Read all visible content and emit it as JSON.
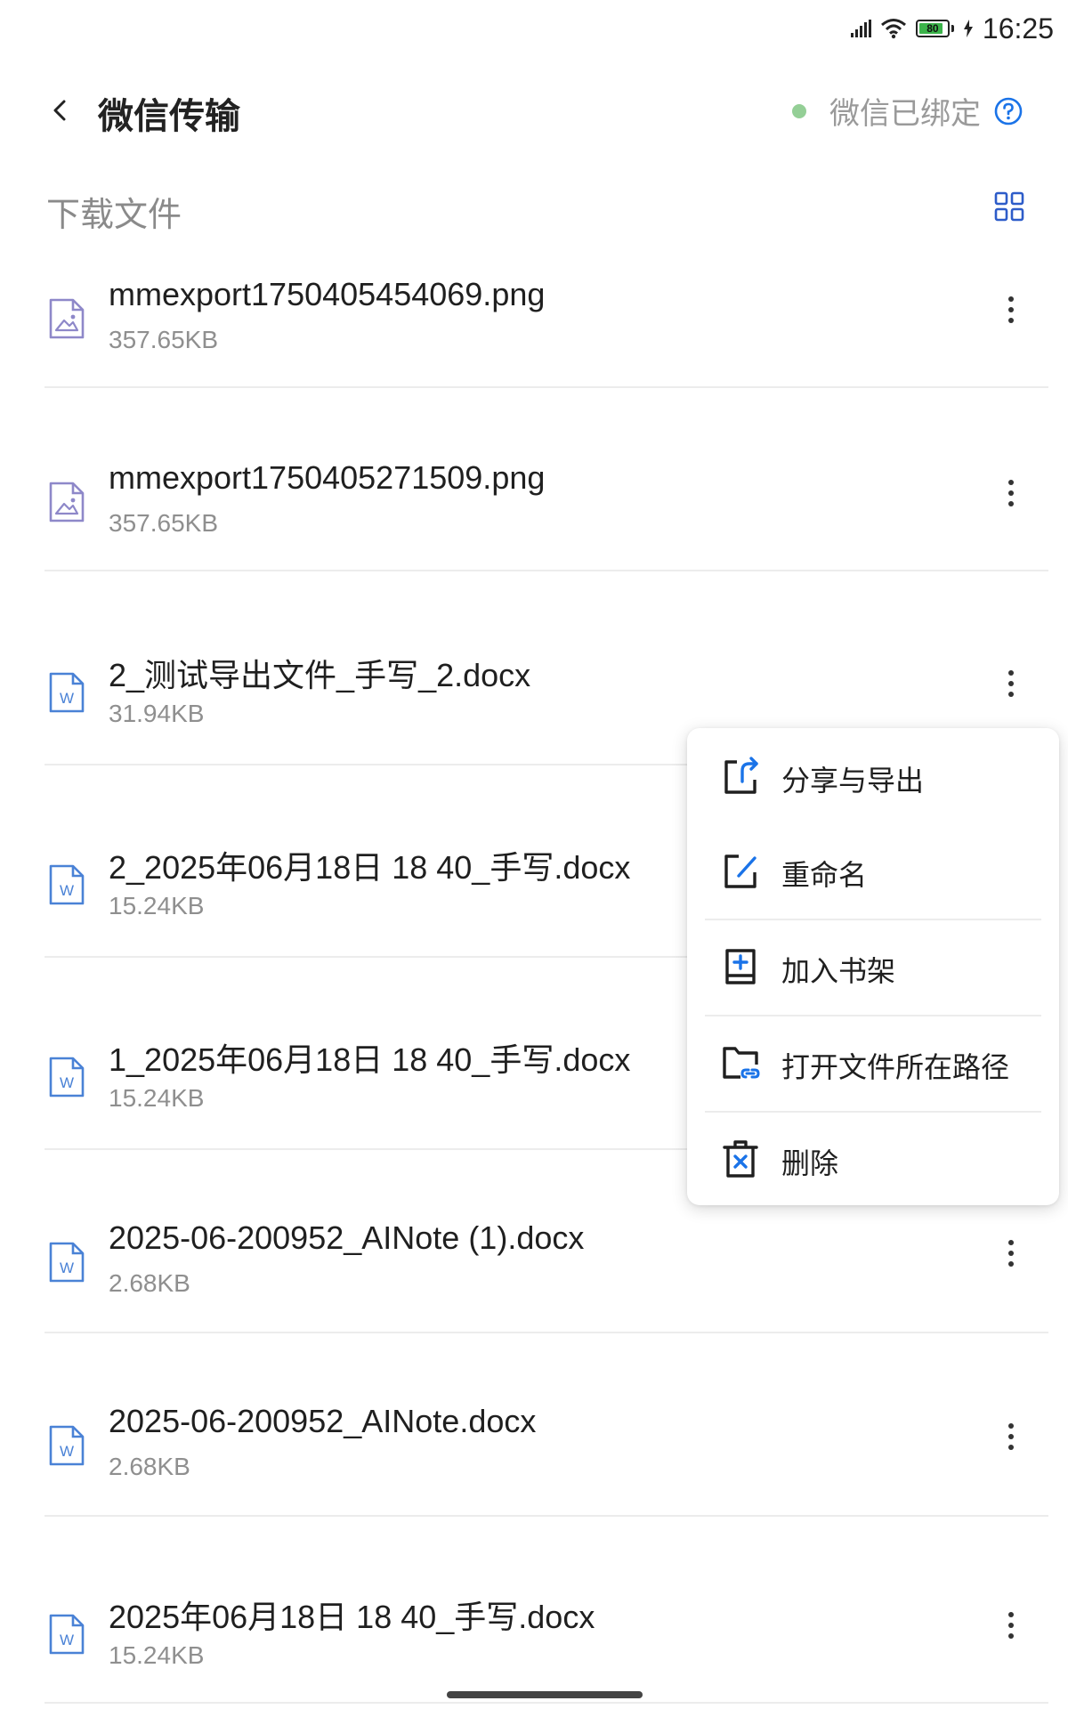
{
  "status_bar": {
    "time": "16:25",
    "battery": "80"
  },
  "header": {
    "title": "微信传输",
    "bind_status": "微信已绑定"
  },
  "section": {
    "title": "下载文件"
  },
  "files": [
    {
      "name": "mmexport1750405454069.png",
      "size": "357.65KB",
      "type": "image-file-icon"
    },
    {
      "name": "mmexport1750405271509.png",
      "size": "357.65KB",
      "type": "image-file-icon"
    },
    {
      "name": "2_测试导出文件_手写_2.docx",
      "size": "31.94KB",
      "type": "word-file-icon"
    },
    {
      "name": "2_2025年06月18日 18 40_手写.docx",
      "size": "15.24KB",
      "type": "word-file-icon"
    },
    {
      "name": "1_2025年06月18日 18 40_手写.docx",
      "size": "15.24KB",
      "type": "word-file-icon"
    },
    {
      "name": "2025-06-200952_AINote (1).docx",
      "size": "2.68KB",
      "type": "word-file-icon"
    },
    {
      "name": "2025-06-200952_AINote.docx",
      "size": "2.68KB",
      "type": "word-file-icon"
    },
    {
      "name": "2025年06月18日 18 40_手写.docx",
      "size": "15.24KB",
      "type": "word-file-icon"
    }
  ],
  "context_menu": {
    "items": [
      {
        "label": "分享与导出",
        "icon": "share-export-icon"
      },
      {
        "label": "重命名",
        "icon": "rename-icon"
      },
      {
        "label": "加入书架",
        "icon": "add-bookshelf-icon"
      },
      {
        "label": "打开文件所在路径",
        "icon": "open-folder-icon"
      },
      {
        "label": "删除",
        "icon": "delete-icon"
      }
    ]
  },
  "colors": {
    "accent": "#1a73e8",
    "icon_purple": "#8e88c9",
    "icon_blue": "#4a82d6",
    "text_secondary": "#8f8f8f"
  }
}
